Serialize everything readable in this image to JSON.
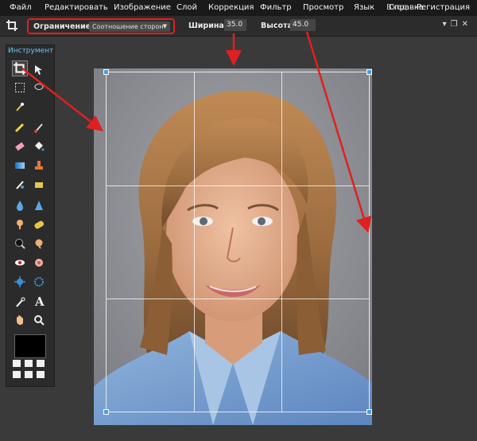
{
  "menu": {
    "items": [
      "Файл",
      "Редактировать",
      "Изображение",
      "Слой",
      "Коррекция",
      "Фильтр",
      "Просмотр",
      "Язык",
      "Вход",
      "Справка",
      "Регистрация"
    ]
  },
  "options_bar": {
    "constraint_label": "Ограничение:",
    "constraint_value": "Соотношение сторон",
    "width_label": "Ширина:",
    "width_value": "35.0",
    "height_label": "Высота:",
    "height_value": "45.0"
  },
  "toolbox": {
    "title": "Инструмент"
  },
  "colors": {
    "annotation": "#e02020",
    "handle": "#4a9de0",
    "accent_title": "#6cc4f0"
  }
}
